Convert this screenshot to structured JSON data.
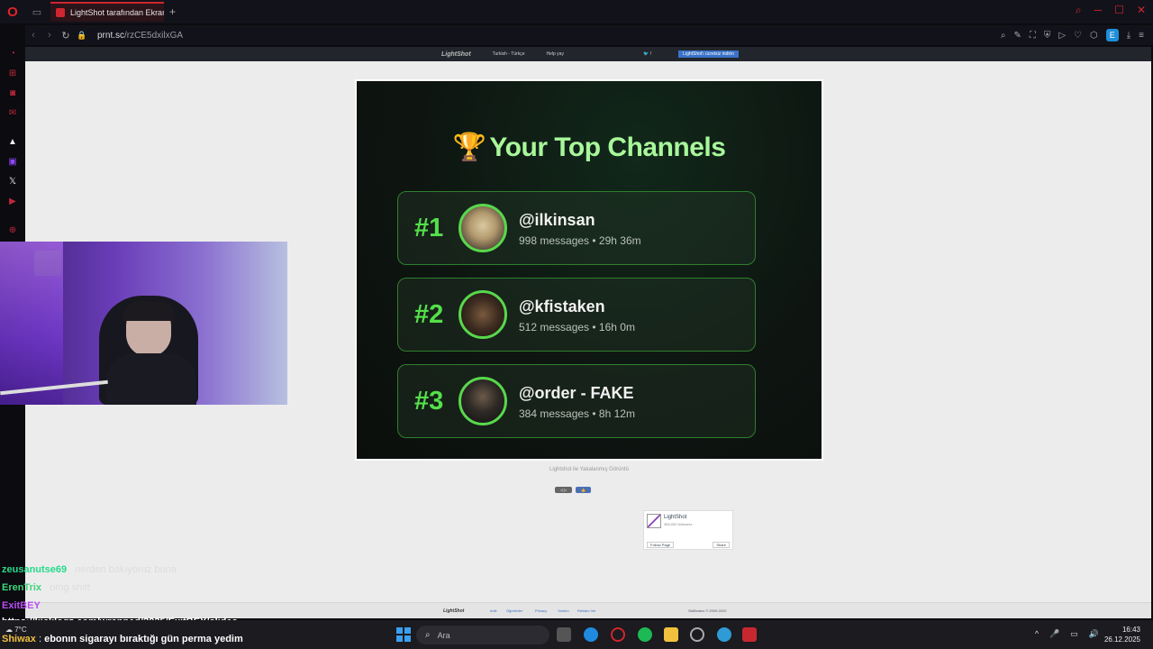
{
  "browser": {
    "tab_title": "LightShot tarafından Ekran",
    "new_tab": "+",
    "url_domain": "prnt.sc",
    "url_path": "/rzCE5dxilxGA",
    "ext_badge": "E"
  },
  "lightshot": {
    "header_logo": "LightShot",
    "header_lang": "Turkish - Türkçe",
    "header_help": "Help yay",
    "header_button": "LightShot'ı ücretsiz indirin",
    "caption": "Lightshot ile Yakalanmış Görüntü",
    "fb_name": "LightShot",
    "fb_followers": "365,000 followers",
    "fb_follow": "Follow Page",
    "fb_share": "Share",
    "footer_copyright": "Skillbrains © 2009-2022",
    "footer_links": [
      "Indir",
      "Öğreticiler",
      "Privacy",
      "Yardım",
      "Reklam Ver"
    ]
  },
  "screenshot": {
    "title": "Your Top Channels",
    "channels": [
      {
        "rank": "#1",
        "name": "@ilkinsan",
        "meta": "998 messages • 29h 36m"
      },
      {
        "rank": "#2",
        "name": "@kfistaken",
        "meta": "512 messages • 16h 0m"
      },
      {
        "rank": "#3",
        "name": "@order - FAKE",
        "meta": "384 messages • 8h 12m"
      }
    ]
  },
  "chat": [
    {
      "user": "zeusanutse69",
      "sep": " : ",
      "text": "nerden bakıyoruz buna",
      "color": "#27d98a"
    },
    {
      "user": "ErenTrix",
      "sep": " : ",
      "text": "omg shitt",
      "color": "#3fd57a"
    },
    {
      "user": "ExitBEY",
      "sep": " :",
      "text": "",
      "color": "#b84cf0"
    },
    {
      "user": "",
      "sep": "",
      "text": "https://kicklogz.com/wrapped/2025/ExitBEY/slides",
      "color": "#ffffff"
    },
    {
      "user": "Shiwax",
      "sep": " : ",
      "text": "ebonın sigarayı bıraktığı gün perma yedim",
      "color": "#f0c040"
    }
  ],
  "taskbar": {
    "search_placeholder": "Ara",
    "time": "16:43",
    "date": "26.12.2025",
    "weather": "7°C"
  },
  "colors": {
    "accent_green": "#54e04a",
    "title_green": "#a8f79a",
    "opera_red": "#d0262f"
  }
}
